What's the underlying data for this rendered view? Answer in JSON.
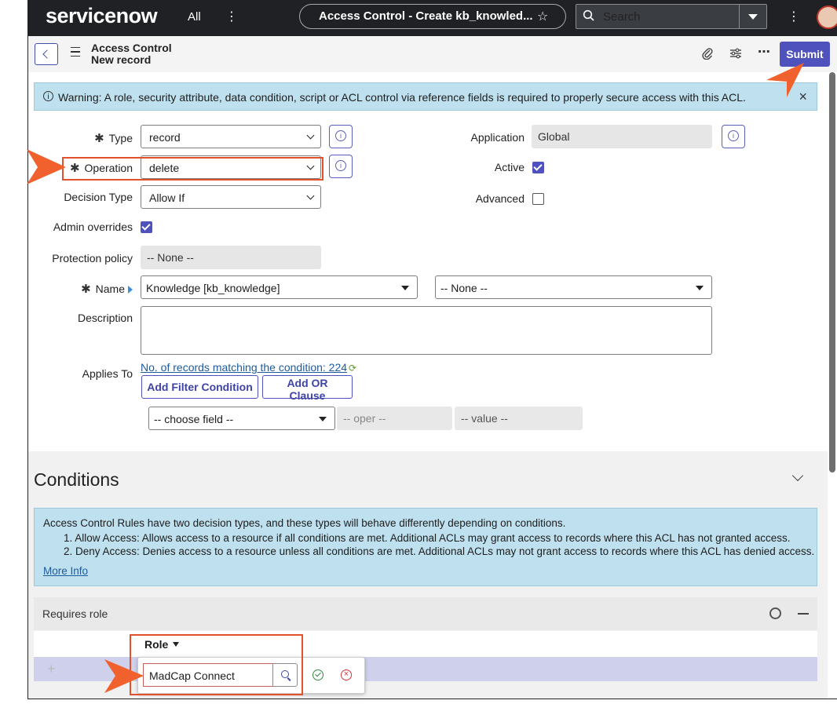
{
  "topnav": {
    "logo": "servicenow",
    "all_label": "All",
    "record_title": "Access Control - Create kb_knowled...",
    "search_label": "Search"
  },
  "header": {
    "line1": "Access Control",
    "line2": "New record",
    "submit_label": "Submit"
  },
  "warning": {
    "text": "Warning: A role, security attribute, data condition, script or ACL control via reference fields is required to properly secure access with this ACL."
  },
  "form": {
    "type_label": "Type",
    "type_value": "record",
    "operation_label": "Operation",
    "operation_value": "delete",
    "decision_label": "Decision Type",
    "decision_value": "Allow If",
    "admin_label": "Admin overrides",
    "admin_checked": true,
    "protection_label": "Protection policy",
    "protection_value": "-- None --",
    "name_label": "Name",
    "name_value": "Knowledge [kb_knowledge]",
    "name_field_value": "-- None --",
    "description_label": "Description",
    "description_value": "",
    "applies_label": "Applies To",
    "records_link": "No. of records matching the condition: 224",
    "add_filter": "Add Filter Condition",
    "add_or": "Add OR Clause",
    "choose_field": "-- choose field --",
    "oper": "-- oper --",
    "value": "-- value --",
    "application_label": "Application",
    "application_value": "Global",
    "active_label": "Active",
    "active_checked": true,
    "advanced_label": "Advanced",
    "advanced_checked": false
  },
  "conditions": {
    "title": "Conditions",
    "intro": "Access Control Rules have two decision types, and these types will behave differently depending on conditions.",
    "item1": "1. Allow Access: Allows access to a resource if all conditions are met. Additional ACLs may grant access to records where this ACL has not granted access.",
    "item2": "2. Deny Access: Denies access to a resource unless all conditions are met. Additional ACLs may not grant access to records where this ACL has denied access.",
    "more_info": "More Info"
  },
  "requires_role": {
    "title": "Requires role",
    "column": "Role",
    "input_value": "MadCap Connect"
  },
  "colors": {
    "accent": "#4f52bd",
    "nav_bg": "#1f2124",
    "annotation": "#e1522c",
    "info_bg": "#bfe0ee"
  }
}
